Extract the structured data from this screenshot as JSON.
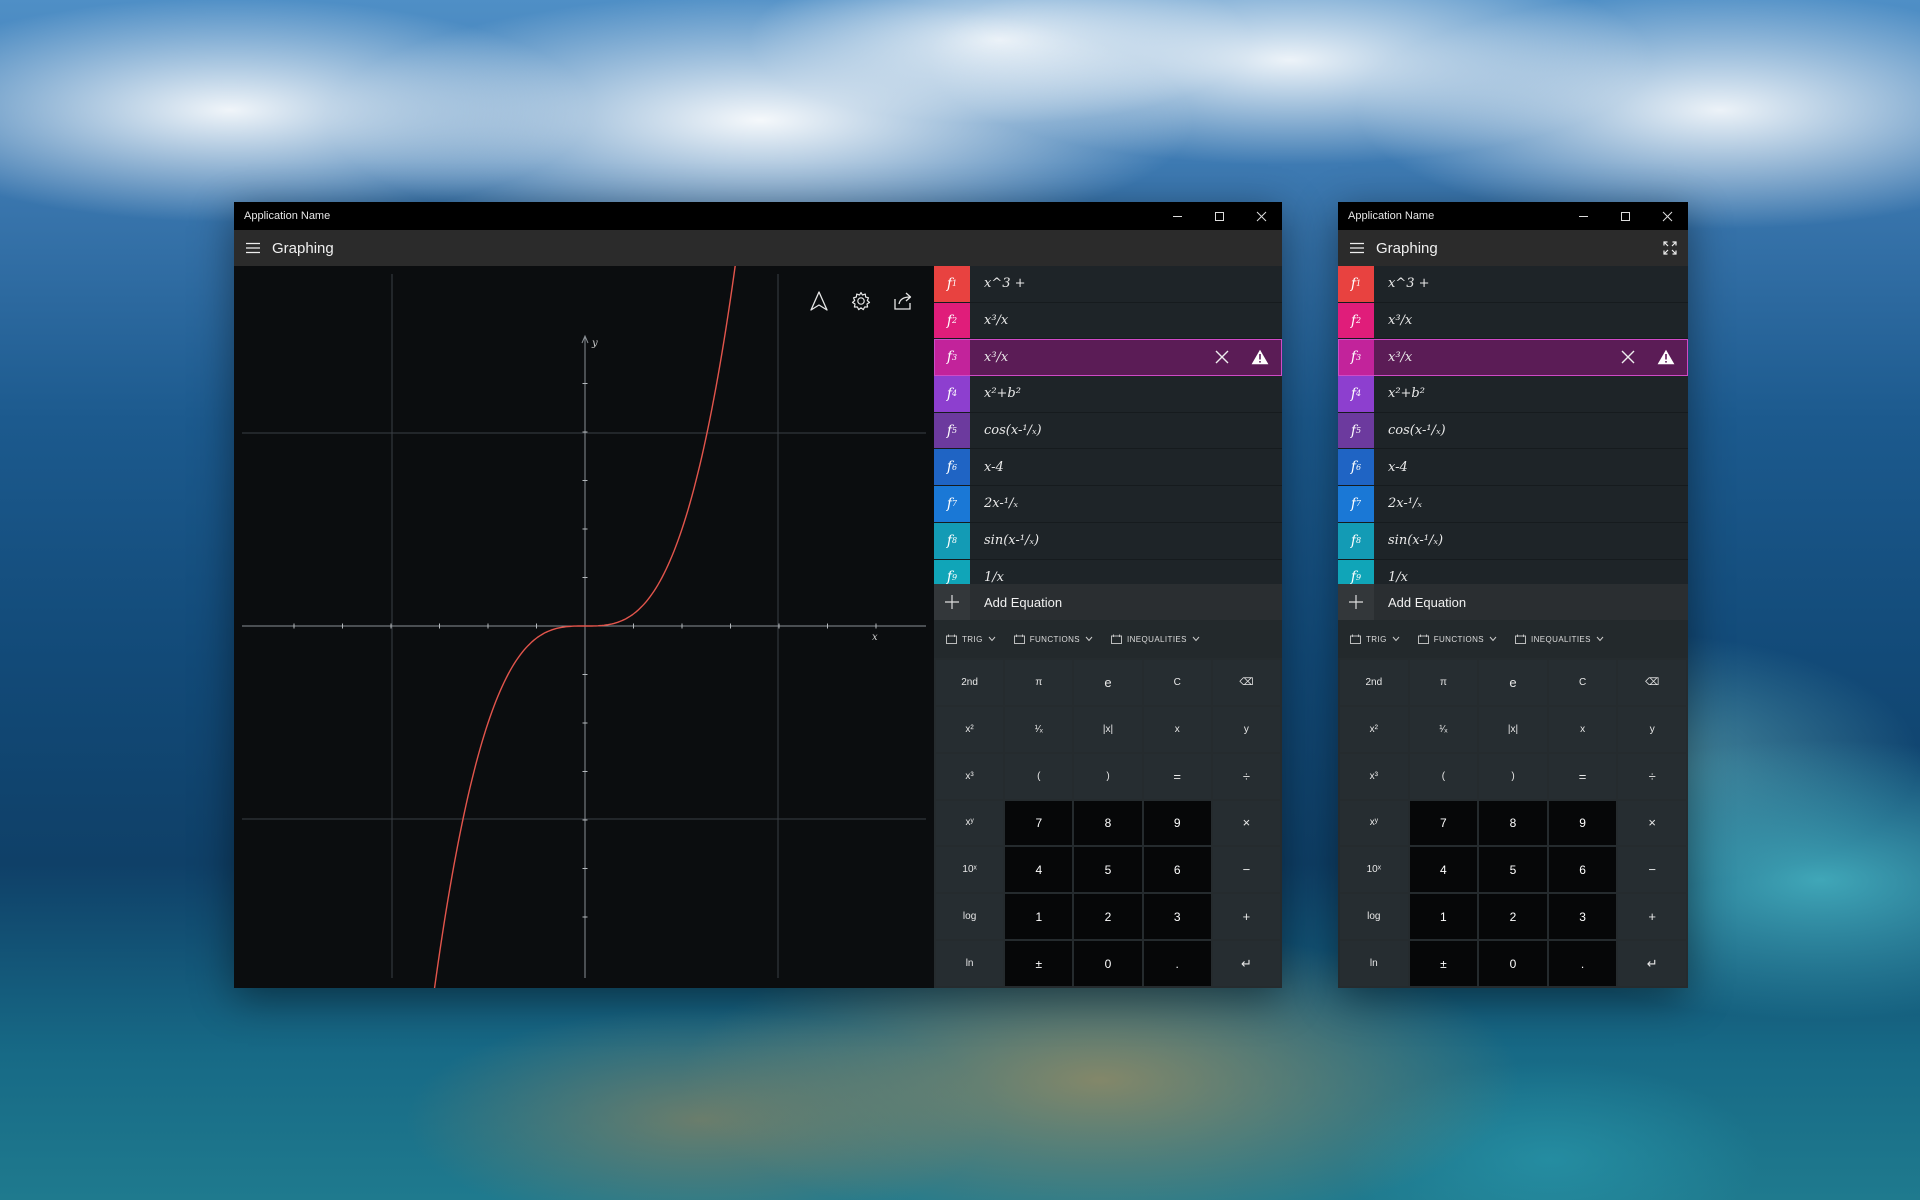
{
  "colors": {
    "curve": "#e2554c",
    "selected_bg": "#5b1c56",
    "selected_border": "#d04ac6",
    "badges": [
      "#e84240",
      "#e01d7a",
      "#c2239b",
      "#8d3fcf",
      "#6c3a9e",
      "#1f64c4",
      "#1a78d6",
      "#139bb5",
      "#10a5b8"
    ]
  },
  "windows": {
    "main": {
      "title": "Application Name",
      "app_title": "Graphing",
      "graph": {
        "x_label": "x",
        "y_label": "y",
        "curve_function": "x^3",
        "toolbar_icons": [
          "trace-icon",
          "settings-icon",
          "share-icon"
        ]
      }
    },
    "compact": {
      "title": "Application Name",
      "app_title": "Graphing"
    }
  },
  "equations": [
    {
      "id": "f1",
      "label": "f",
      "sub": "1",
      "text": "x^3 +"
    },
    {
      "id": "f2",
      "label": "f",
      "sub": "2",
      "text": "x³/x"
    },
    {
      "id": "f3",
      "label": "f",
      "sub": "3",
      "text": "x³/x",
      "selected": true
    },
    {
      "id": "f4",
      "label": "f",
      "sub": "4",
      "text": "x²+b²"
    },
    {
      "id": "f5",
      "label": "f",
      "sub": "5",
      "text": "cos(x-¹/ₓ)"
    },
    {
      "id": "f6",
      "label": "f",
      "sub": "6",
      "text": "x-4"
    },
    {
      "id": "f7",
      "label": "f",
      "sub": "7",
      "text": "2x-¹/ₓ"
    },
    {
      "id": "f8",
      "label": "f",
      "sub": "8",
      "text": "sin(x-¹/ₓ)"
    },
    {
      "id": "f9",
      "label": "f",
      "sub": "9",
      "text": "1/x"
    }
  ],
  "add_equation": "Add Equation",
  "func_menus": [
    "TRIG",
    "FUNCTIONS",
    "INEQUALITIES"
  ],
  "keypad": [
    {
      "k": "2nd",
      "t": "fn"
    },
    {
      "k": "π",
      "t": "fn"
    },
    {
      "k": "e",
      "t": "fn",
      "big": true
    },
    {
      "k": "C",
      "t": "fn"
    },
    {
      "k": "⌫",
      "t": "fn"
    },
    {
      "k": "x²",
      "t": "fn"
    },
    {
      "k": "¹⁄ₓ",
      "t": "fn"
    },
    {
      "k": "|x|",
      "t": "fn"
    },
    {
      "k": "x",
      "t": "fn"
    },
    {
      "k": "y",
      "t": "fn"
    },
    {
      "k": "x³",
      "t": "fn"
    },
    {
      "k": "(",
      "t": "fn"
    },
    {
      "k": ")",
      "t": "fn"
    },
    {
      "k": "=",
      "t": "fn",
      "big": true
    },
    {
      "k": "÷",
      "t": "fn",
      "big": true
    },
    {
      "k": "xʸ",
      "t": "fn"
    },
    {
      "k": "7",
      "t": "num"
    },
    {
      "k": "8",
      "t": "num"
    },
    {
      "k": "9",
      "t": "num"
    },
    {
      "k": "×",
      "t": "fn",
      "big": true
    },
    {
      "k": "10ˣ",
      "t": "fn"
    },
    {
      "k": "4",
      "t": "num"
    },
    {
      "k": "5",
      "t": "num"
    },
    {
      "k": "6",
      "t": "num"
    },
    {
      "k": "−",
      "t": "fn",
      "big": true
    },
    {
      "k": "log",
      "t": "fn"
    },
    {
      "k": "1",
      "t": "num"
    },
    {
      "k": "2",
      "t": "num"
    },
    {
      "k": "3",
      "t": "num"
    },
    {
      "k": "+",
      "t": "fn",
      "big": true
    },
    {
      "k": "ln",
      "t": "fn"
    },
    {
      "k": "±",
      "t": "num"
    },
    {
      "k": "0",
      "t": "num"
    },
    {
      "k": ".",
      "t": "num"
    },
    {
      "k": "↵",
      "t": "fn",
      "big": true
    }
  ]
}
